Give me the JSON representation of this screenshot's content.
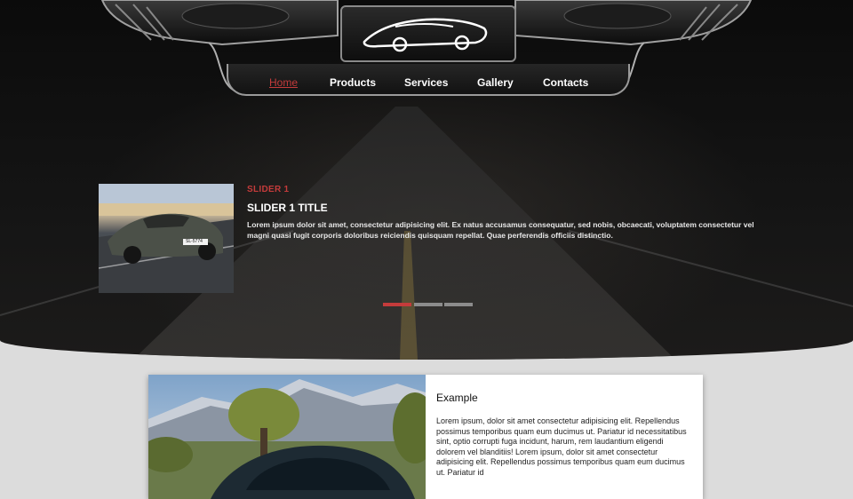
{
  "nav": {
    "items": [
      {
        "label": "Home",
        "active": true
      },
      {
        "label": "Products"
      },
      {
        "label": "Services"
      },
      {
        "label": "Gallery"
      },
      {
        "label": "Contacts"
      }
    ]
  },
  "slider": {
    "kicker": "SLIDER 1",
    "title": "SLIDER 1 TITLE",
    "text": "Lorem ipsum dolor sit amet, consectetur adipisicing elit. Ex natus accusamus consequatur, sed nobis, obcaecati, voluptatem consectetur vel magni quasi fugit corporis doloribus reiciendis quisquam repellat. Quae perferendis officiis distinctio.",
    "plate": "SL-5774",
    "slide_count": 3,
    "active_slide": 1
  },
  "card": {
    "title": "Example",
    "text": "Lorem ipsum, dolor sit amet consectetur adipisicing elit. Repellendus possimus temporibus quam eum ducimus ut. Pariatur id necessitatibus sint, optio corrupti fuga incidunt, harum, rem laudantium eligendi dolorem vel blanditiis! Lorem ipsum, dolor sit amet consectetur adipisicing elit. Repellendus possimus temporibus quam eum ducimus ut. Pariatur id"
  },
  "colors": {
    "accent": "#c43b3b",
    "page_bg": "#dcdcdc",
    "hero_bg": "#111111"
  },
  "icons": [
    "car-logo-icon"
  ]
}
